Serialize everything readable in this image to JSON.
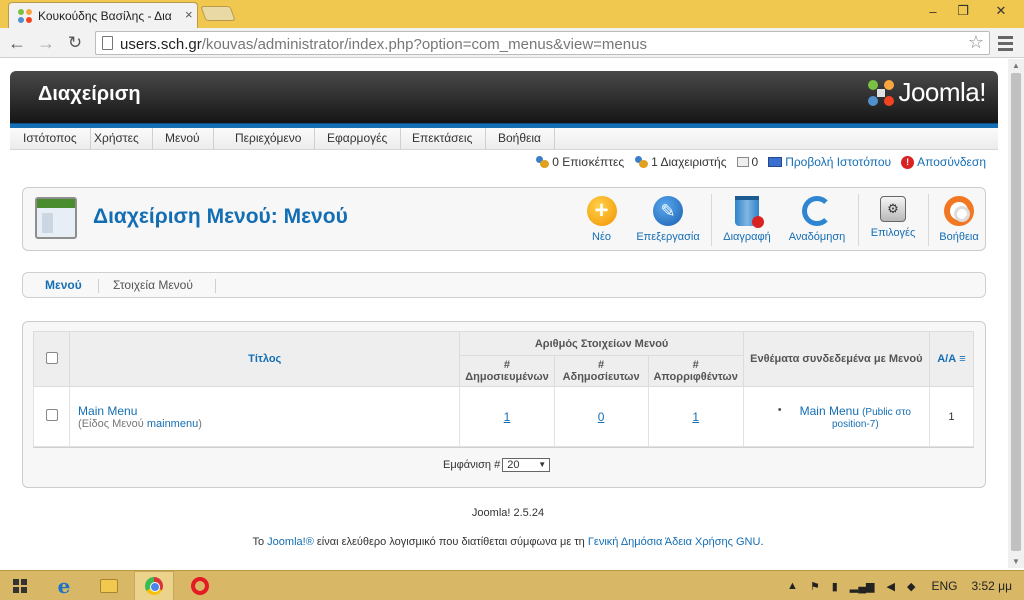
{
  "browser": {
    "tab_title": "Κουκούδης Βασίλης - Δια",
    "tab_close": "×",
    "url_host": "users.sch.gr",
    "url_path": "/kouvas/administrator/index.php?option=com_menus&view=menus",
    "window_controls": [
      "–",
      "❐",
      "✕"
    ]
  },
  "header": {
    "admin_title": "Διαχείριση",
    "logo_text": "Joomla!"
  },
  "menubar": {
    "items": [
      "Ιστότοπος",
      "Χρήστες",
      "Μενού",
      "Περιεχόμενο",
      "Εφαρμογές",
      "Επεκτάσεις",
      "Βοήθεια"
    ]
  },
  "status": {
    "visitors": "0 Επισκέπτες",
    "admins": "1 Διαχειριστής",
    "messages": "0",
    "view_site": "Προβολή Ιστοτόπου",
    "logout": "Αποσύνδεση"
  },
  "titlebar": {
    "heading": "Διαχείριση Μενού: Μενού",
    "buttons": {
      "new": "Νέο",
      "edit": "Επεξεργασία",
      "delete": "Διαγραφή",
      "rebuild": "Αναδόμηση",
      "options": "Επιλογές",
      "help": "Βοήθεια"
    }
  },
  "subnav": {
    "menus": "Μενού",
    "menu_items": "Στοιχεία Μενού"
  },
  "table": {
    "col_title": "Τίτλος",
    "col_group": "Αριθμός Στοιχείων Μενού",
    "col_published_hash": "#",
    "col_published": "Δημοσιευμένων",
    "col_unpublished_hash": "#",
    "col_unpublished": "Αδημοσίευτων",
    "col_trashed_hash": "#",
    "col_trashed": "Απορριφθέντων",
    "col_modules": "Ενθέματα συνδεδεμένα με Μενού",
    "col_id": "Α/Α",
    "rows": [
      {
        "title": "Main Menu",
        "type_prefix": "(Είδος Μενού",
        "type_value": "mainmenu",
        "type_suffix": ")",
        "published": "1",
        "unpublished": "0",
        "trashed": "1",
        "module_name": "Main Menu",
        "module_info": "(Public στο position-7)",
        "id": "1"
      }
    ],
    "display_label": "Εμφάνιση #",
    "display_value": "20"
  },
  "footer": {
    "version": "Joomla! 2.5.24",
    "license_prefix": "Το",
    "license_link1": "Joomla!®",
    "license_middle": "είναι ελεύθερο λογισμικό που διατίθεται σύμφωνα με τη",
    "license_link2": "Γενική Δημόσια Άδεια Χρήσης GNU",
    "license_suffix": "."
  },
  "taskbar": {
    "lang": "ENG",
    "clock": "3:52 μμ"
  }
}
